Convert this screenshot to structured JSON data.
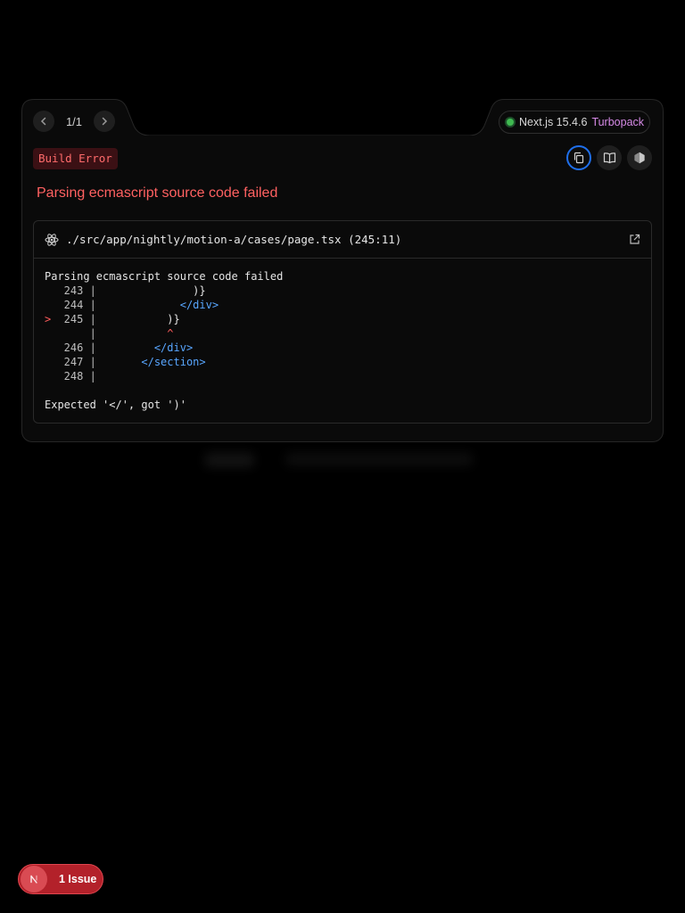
{
  "pagination": {
    "count_label": "1/1"
  },
  "version": {
    "framework": "Next.js 15.4.6",
    "bundler": "Turbopack"
  },
  "error": {
    "type_label": "Build Error",
    "message": "Parsing ecmascript source code failed"
  },
  "code_frame": {
    "file": "./src/app/nightly/motion-a/cases/page.tsx (245:11)",
    "heading": "Parsing ecmascript source code failed",
    "lines": [
      {
        "marker": " ",
        "number": "243",
        "code": "              )}",
        "kind": "plain"
      },
      {
        "marker": " ",
        "number": "244",
        "code": "            </div>",
        "kind": "tag"
      },
      {
        "marker": ">",
        "number": "245",
        "code": "          )}",
        "kind": "plain"
      },
      {
        "marker": " ",
        "number": "",
        "code": "          ^",
        "kind": "caret"
      },
      {
        "marker": " ",
        "number": "246",
        "code": "        </div>",
        "kind": "tag"
      },
      {
        "marker": " ",
        "number": "247",
        "code": "      </section>",
        "kind": "tag"
      },
      {
        "marker": " ",
        "number": "248",
        "code": "",
        "kind": "plain"
      }
    ],
    "footer": "Expected '</', got ')'"
  },
  "issues": {
    "label": "1 Issue"
  },
  "icons": {
    "prev": "chevron-left-icon",
    "next": "chevron-right-icon",
    "copy": "copy-icon",
    "docs": "book-icon",
    "nodejs": "hexagon-icon",
    "react": "react-icon",
    "external": "external-link-icon",
    "issue_logo": "nextjs-logo-icon"
  },
  "colors": {
    "error_red": "#ff6161",
    "tag_blue": "#58a6ff",
    "status_green": "#3fb950",
    "bundler_pink": "#d68ae6",
    "focus_blue": "#1f6feb"
  }
}
